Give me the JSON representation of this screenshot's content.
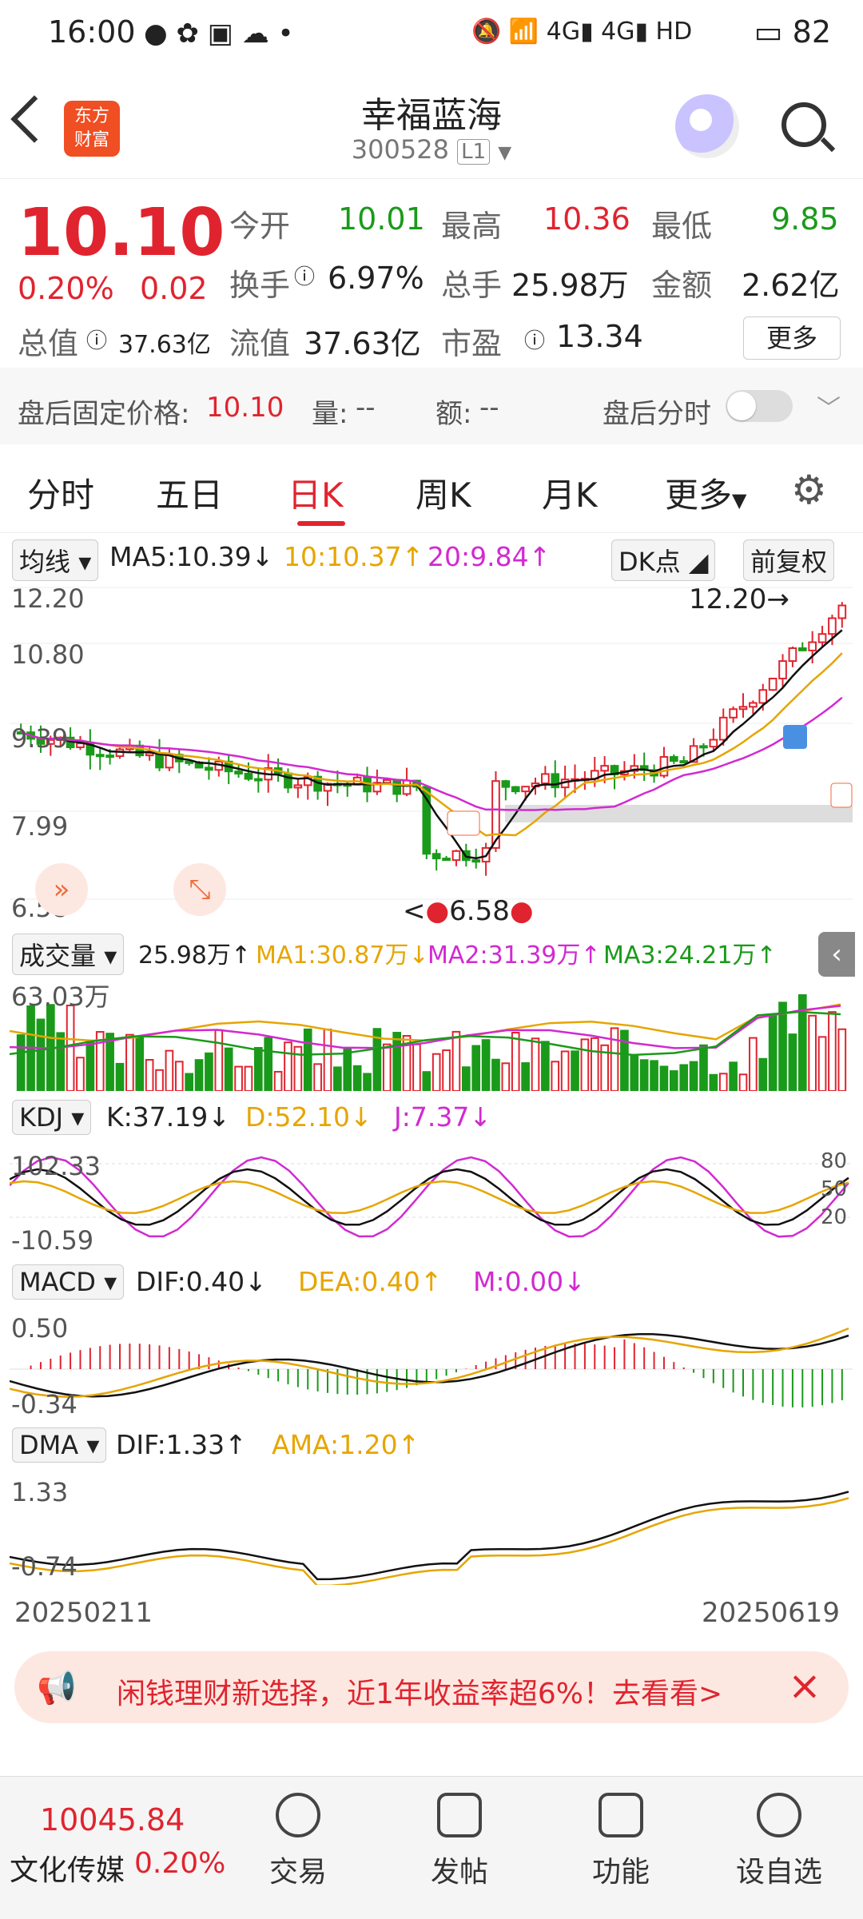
{
  "status_bar": {
    "time": "16:00",
    "battery": "82"
  },
  "header": {
    "title": "幸福蓝海",
    "code": "300528",
    "level_badge": "L1",
    "logo_text": "东方财富"
  },
  "quote": {
    "price": "10.10",
    "change_pct": "0.20%",
    "change_abs": "0.02",
    "open_label": "今开",
    "open": "10.01",
    "high_label": "最高",
    "high": "10.36",
    "low_label": "最低",
    "low": "9.85",
    "turnover_label": "换手",
    "turnover": "6.97%",
    "volume_label": "总手",
    "volume": "25.98万",
    "amount_label": "金额",
    "amount": "2.62亿",
    "mktcap_label": "总值",
    "mktcap": "37.63亿",
    "float_label": "流值",
    "float": "37.63亿",
    "pe_label": "市盈",
    "pe": "13.34",
    "more_button": "更多"
  },
  "after_hours": {
    "price_label": "盘后固定价格:",
    "price": "10.10",
    "vol_label": "量:",
    "vol": "--",
    "amt_label": "额:",
    "amt": "--",
    "timeshare_label": "盘后分时"
  },
  "tabs": [
    {
      "label": "分时"
    },
    {
      "label": "五日"
    },
    {
      "label": "日K"
    },
    {
      "label": "周K"
    },
    {
      "label": "月K"
    },
    {
      "label": "更多"
    }
  ],
  "ma": {
    "selector": "均线",
    "ma5": "MA5:10.39↓",
    "ma10": "10:10.37↑",
    "ma20": "20:9.84↑",
    "dk_button": "DK点",
    "adjust_button": "前复权"
  },
  "price_axis": {
    "top": "12.20",
    "l2": "10.80",
    "l3": "9.39",
    "l4": "7.99",
    "bottom": "6.58",
    "max_label": "12.20",
    "min_label": "6.58"
  },
  "volume": {
    "selector": "成交量",
    "value": "25.98万↑",
    "ma1": "MA1:30.87万↓",
    "ma2": "MA2:31.39万↑",
    "ma3": "MA3:24.21万↑",
    "max_axis": "63.03万"
  },
  "kdj": {
    "selector": "KDJ",
    "k": "K:37.19↓",
    "d": "D:52.10↓",
    "j": "J:7.37↓",
    "top": "102.33",
    "bottom": "-10.59",
    "l80": "80",
    "l50": "50",
    "l20": "20"
  },
  "macd": {
    "selector": "MACD",
    "dif": "DIF:0.40↓",
    "dea": "DEA:0.40↑",
    "m": "M:0.00↓",
    "top": "0.50",
    "bottom": "-0.34"
  },
  "dma": {
    "selector": "DMA",
    "dif": "DIF:1.33↑",
    "ama": "AMA:1.20↑",
    "top": "1.33",
    "bottom": "-0.74"
  },
  "dates": {
    "start": "20250211",
    "end": "20250619"
  },
  "ad": {
    "text": "闲钱理财新选择，近1年收益率超6%！去看看>"
  },
  "bottom_bar": {
    "index_value": "10045.84",
    "index_name": "文化传媒",
    "index_change": "0.20%",
    "items": [
      {
        "label": "交易"
      },
      {
        "label": "发帖"
      },
      {
        "label": "功能"
      },
      {
        "label": "设自选"
      }
    ]
  },
  "colors": {
    "up": "#e0242f",
    "down": "#1a9a1a",
    "ma10": "#e6a500",
    "ma20": "#d12ad1"
  }
}
